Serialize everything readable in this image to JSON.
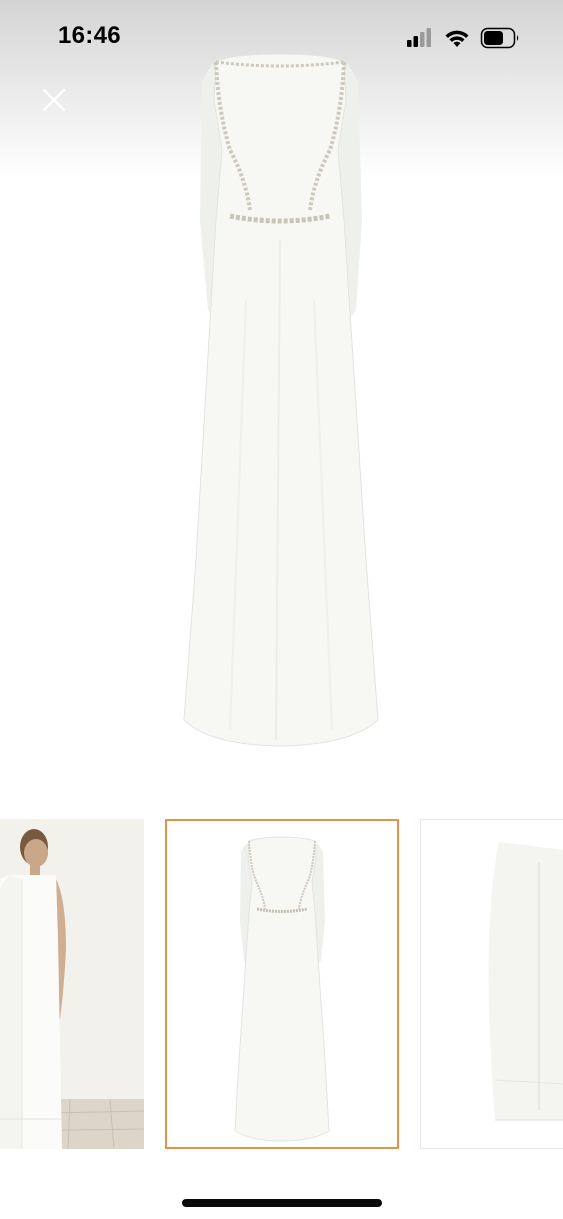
{
  "status_bar": {
    "time": "16:46",
    "icons": [
      "cellular-signal-icon",
      "wifi-icon",
      "battery-icon"
    ],
    "battery_level": 0.6
  },
  "viewer": {
    "close_icon": "close-icon",
    "main_image_description": "white-maxi-dress-with-cape"
  },
  "thumbnails": [
    {
      "name": "thumbnail-model-back",
      "selected": false
    },
    {
      "name": "thumbnail-dress-front",
      "selected": true
    },
    {
      "name": "thumbnail-dress-back-detail",
      "selected": false
    }
  ],
  "colors": {
    "selection_border": "#e0944a",
    "top_gradient": "#d4d4d4",
    "dress": "#f7f7f4"
  }
}
